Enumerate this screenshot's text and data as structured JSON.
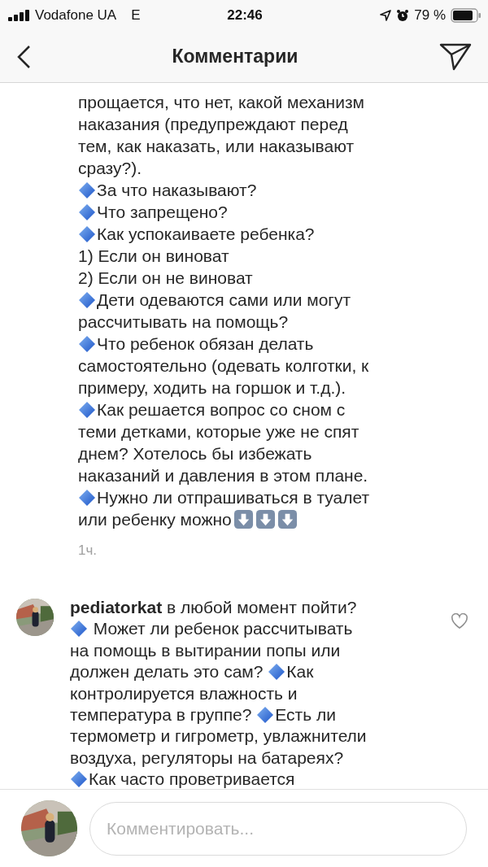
{
  "status_bar": {
    "carrier": "Vodafone UA",
    "network": "E",
    "time": "22:46",
    "battery": "79 %"
  },
  "header": {
    "title": "Комментарии"
  },
  "comments": [
    {
      "time": "1ч.",
      "lines": [
        [
          {
            "kind": "text",
            "text": "прощается, что нет, какой механизм"
          }
        ],
        [
          {
            "kind": "text",
            "text": "наказания (предупреждают перед"
          }
        ],
        [
          {
            "kind": "text",
            "text": "тем, как наказать, или наказывают"
          }
        ],
        [
          {
            "kind": "text",
            "text": "сразу?)."
          }
        ],
        [
          {
            "kind": "diamond"
          },
          {
            "kind": "text",
            "text": "За что наказывают?"
          }
        ],
        [
          {
            "kind": "diamond"
          },
          {
            "kind": "text",
            "text": "Что запрещено?"
          }
        ],
        [
          {
            "kind": "diamond"
          },
          {
            "kind": "text",
            "text": "Как успокаиваете ребенка?"
          }
        ],
        [
          {
            "kind": "text",
            "text": "1) Если он виноват"
          }
        ],
        [
          {
            "kind": "text",
            "text": "2) Если он не виноват"
          }
        ],
        [
          {
            "kind": "diamond"
          },
          {
            "kind": "text",
            "text": "Дети одеваются сами или могут"
          }
        ],
        [
          {
            "kind": "text",
            "text": "рассчитывать на помощь?"
          }
        ],
        [
          {
            "kind": "diamond"
          },
          {
            "kind": "text",
            "text": "Что ребенок обязан делать"
          }
        ],
        [
          {
            "kind": "text",
            "text": "самостоятельно (одевать колготки, к"
          }
        ],
        [
          {
            "kind": "text",
            "text": "примеру, ходить на горшок и т.д.)."
          }
        ],
        [
          {
            "kind": "diamond"
          },
          {
            "kind": "text",
            "text": "Как решается вопрос со сном с"
          }
        ],
        [
          {
            "kind": "text",
            "text": "теми детками, которые уже не спят"
          }
        ],
        [
          {
            "kind": "text",
            "text": "днем? Хотелось бы избежать"
          }
        ],
        [
          {
            "kind": "text",
            "text": "наказаний и давления в этом плане."
          }
        ],
        [
          {
            "kind": "diamond"
          },
          {
            "kind": "text",
            "text": "Нужно ли отпрашиваться в туалет"
          }
        ],
        [
          {
            "kind": "text",
            "text": "или ребенку можно"
          },
          {
            "kind": "arrow"
          },
          {
            "kind": "arrow"
          },
          {
            "kind": "arrow"
          }
        ]
      ]
    },
    {
      "avatar": {
        "kind": "picture"
      },
      "liked": false,
      "lines": [
        [
          {
            "kind": "username",
            "text": "pediatorkat"
          },
          {
            "kind": "text",
            "text": " в любой момент пойти?"
          }
        ],
        [
          {
            "kind": "diamond"
          },
          {
            "kind": "text",
            "text": " Может ли ребенок рассчитывать"
          }
        ],
        [
          {
            "kind": "text",
            "text": "на помощь в вытирании попы или"
          }
        ],
        [
          {
            "kind": "text",
            "text": "должен делать это сам? "
          },
          {
            "kind": "diamond"
          },
          {
            "kind": "text",
            "text": "Как"
          }
        ],
        [
          {
            "kind": "text",
            "text": "контролируется влажность и"
          }
        ],
        [
          {
            "kind": "text",
            "text": "температура в группе? "
          },
          {
            "kind": "diamond"
          },
          {
            "kind": "text",
            "text": "Есть ли"
          }
        ],
        [
          {
            "kind": "text",
            "text": "термометр и гигрометр, увлажнители"
          }
        ],
        [
          {
            "kind": "text",
            "text": "воздуха, регуляторы на батареях?"
          }
        ],
        [
          {
            "kind": "diamond"
          },
          {
            "kind": "text",
            "text": "Как часто проветривается"
          }
        ]
      ]
    }
  ],
  "composer": {
    "avatar": {
      "kind": "picture"
    },
    "placeholder": "Комментировать..."
  }
}
